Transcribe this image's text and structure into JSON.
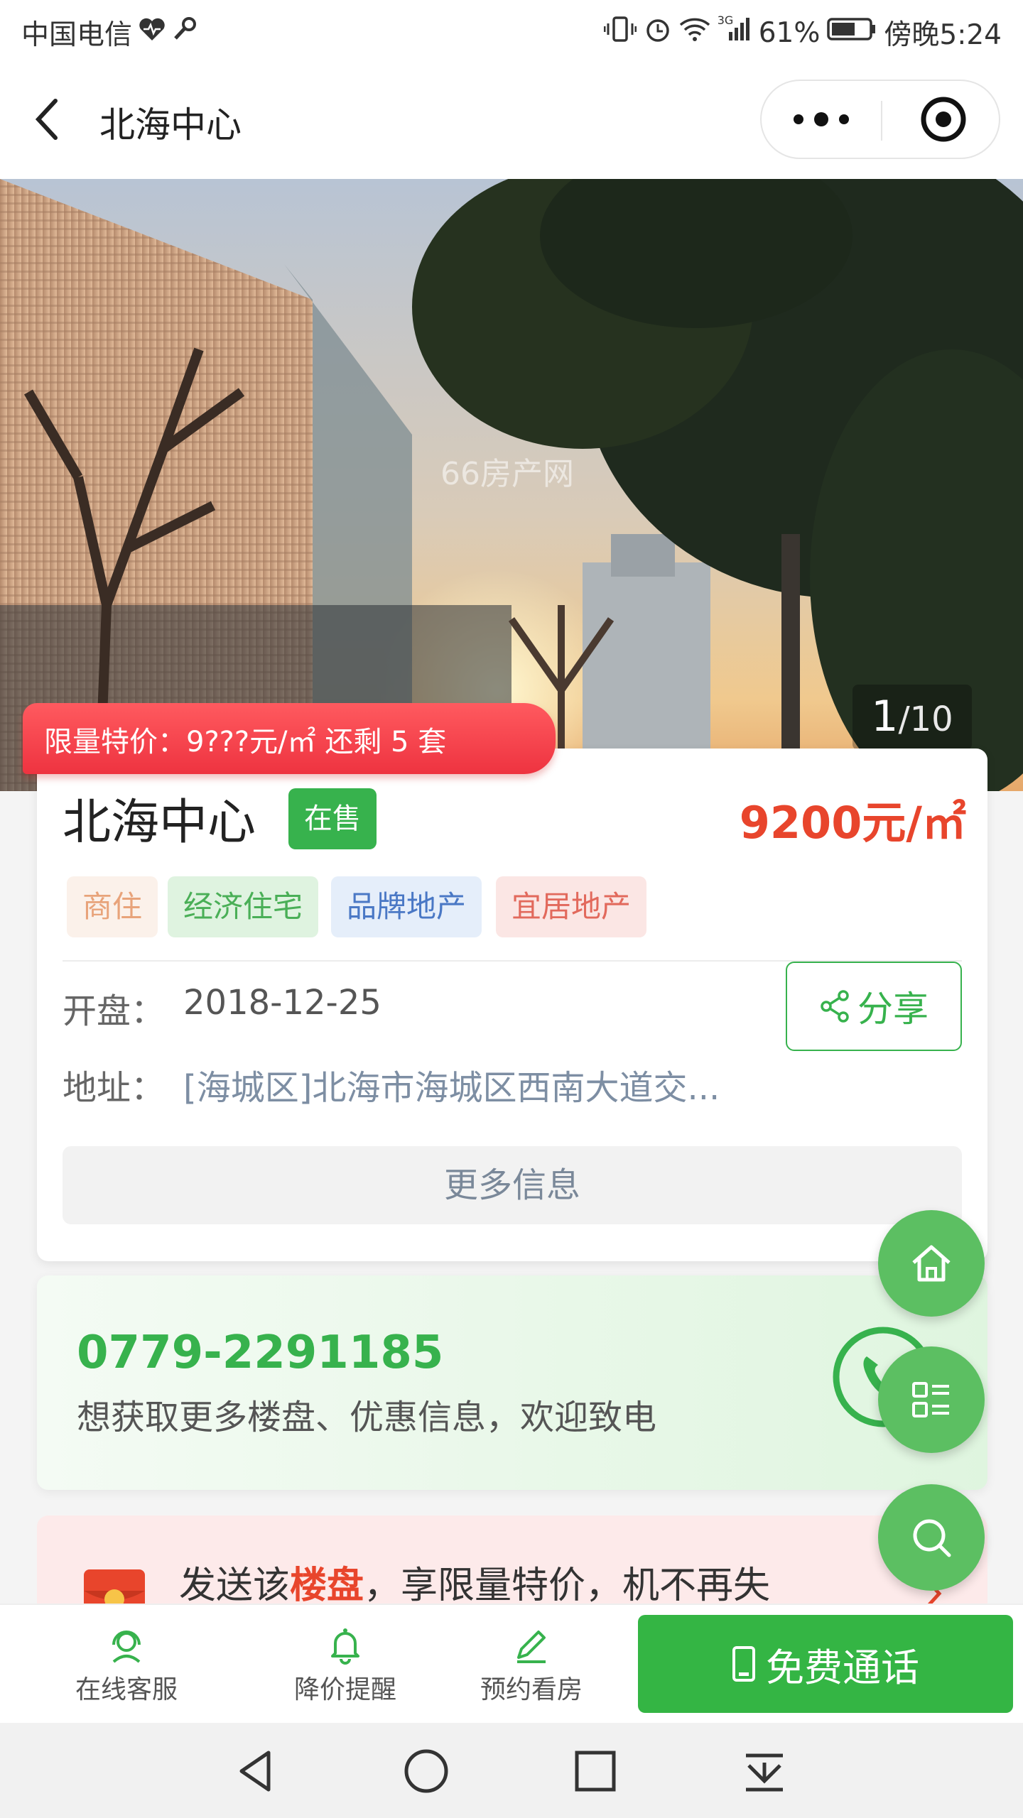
{
  "status_bar": {
    "carrier": "中国电信",
    "battery": "61%",
    "time": "傍晚5:24",
    "network": "3G"
  },
  "nav": {
    "title": "北海中心"
  },
  "gallery": {
    "current": "1",
    "total": "/10",
    "watermark": "66房产网"
  },
  "promo": {
    "text": "限量特价：9???元/㎡ 还剩 5 套"
  },
  "project": {
    "name": "北海中心",
    "status": "在售",
    "price": "9200元/㎡",
    "tags": [
      "商住",
      "经济住宅",
      "品牌地产",
      "宜居地产"
    ],
    "open_label": "开盘：",
    "open_date": "2018-12-25",
    "address_label": "地址：",
    "address": "[海城区]北海市海城区西南大道交...",
    "share_label": "分享",
    "more_label": "更多信息"
  },
  "phone_card": {
    "number": "0779-2291185",
    "desc": "想获取更多楼盘、优惠信息，欢迎致电"
  },
  "redpacket_card": {
    "text_before": "发送该",
    "text_highlight": "楼盘",
    "text_after": "，享限量特价，机不再失"
  },
  "tabbar": {
    "items": [
      {
        "label": "在线客服",
        "icon": "customer-service-icon"
      },
      {
        "label": "降价提醒",
        "icon": "bell-icon"
      },
      {
        "label": "预约看房",
        "icon": "pencil-icon"
      }
    ],
    "call_label": "免费通话"
  },
  "colors": {
    "green": "#37b24d",
    "price_red": "#e8452c",
    "promo_red": "#ff4a52",
    "fab_green": "#5cbf62"
  }
}
